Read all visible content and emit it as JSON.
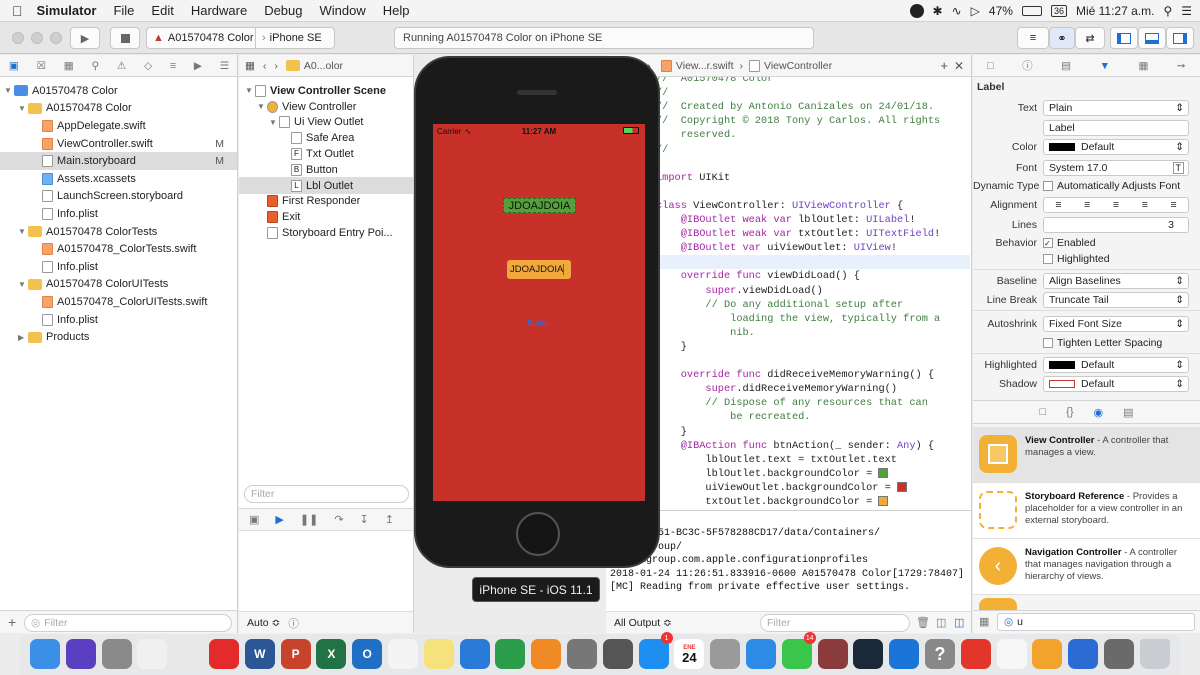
{
  "menubar": {
    "app": "Simulator",
    "items": [
      "File",
      "Edit",
      "Hardware",
      "Debug",
      "Window",
      "Help"
    ],
    "battery": "47%",
    "clock": "Mié 11:27 a.m.",
    "date_badge": "36"
  },
  "toolbar": {
    "scheme": "A01570478 Color",
    "device": "iPhone SE",
    "status": "Running A01570478 Color on iPhone SE"
  },
  "navigator": {
    "items": [
      {
        "label": "A01570478 Color",
        "depth": 0,
        "kind": "project",
        "open": true
      },
      {
        "label": "A01570478 Color",
        "depth": 1,
        "kind": "folder",
        "open": true
      },
      {
        "label": "AppDelegate.swift",
        "depth": 2,
        "kind": "swift"
      },
      {
        "label": "ViewController.swift",
        "depth": 2,
        "kind": "swift",
        "badge": "M"
      },
      {
        "label": "Main.storyboard",
        "depth": 2,
        "kind": "storyboard",
        "badge": "M",
        "selected": true
      },
      {
        "label": "Assets.xcassets",
        "depth": 2,
        "kind": "assets"
      },
      {
        "label": "LaunchScreen.storyboard",
        "depth": 2,
        "kind": "storyboard"
      },
      {
        "label": "Info.plist",
        "depth": 2,
        "kind": "plist"
      },
      {
        "label": "A01570478 ColorTests",
        "depth": 1,
        "kind": "folder",
        "open": true
      },
      {
        "label": "A01570478_ColorTests.swift",
        "depth": 2,
        "kind": "swift"
      },
      {
        "label": "Info.plist",
        "depth": 2,
        "kind": "plist"
      },
      {
        "label": "A01570478 ColorUITests",
        "depth": 1,
        "kind": "folder",
        "open": true
      },
      {
        "label": "A01570478_ColorUITests.swift",
        "depth": 2,
        "kind": "swift"
      },
      {
        "label": "Info.plist",
        "depth": 2,
        "kind": "plist"
      },
      {
        "label": "Products",
        "depth": 1,
        "kind": "folder",
        "open": false
      }
    ],
    "filter_placeholder": "Filter"
  },
  "outline": {
    "jump": "A0...olor",
    "items": [
      {
        "label": "View Controller Scene",
        "depth": 0,
        "bold": true
      },
      {
        "label": "View Controller",
        "depth": 1
      },
      {
        "label": "Ui View Outlet",
        "depth": 2
      },
      {
        "label": "Safe Area",
        "depth": 3
      },
      {
        "label": "Txt Outlet",
        "depth": 3,
        "icon": "F"
      },
      {
        "label": "Button",
        "depth": 3,
        "icon": "B"
      },
      {
        "label": "Lbl Outlet",
        "depth": 3,
        "icon": "L",
        "selected": true
      },
      {
        "label": "First Responder",
        "depth": 1
      },
      {
        "label": "Exit",
        "depth": 1
      },
      {
        "label": "Storyboard Entry Poi...",
        "depth": 1
      }
    ],
    "filter_placeholder": "Filter",
    "auto": "Auto ≎"
  },
  "simulator": {
    "carrier": "Carrier",
    "time": "11:27 AM",
    "label_text": "JDOAJDOIA",
    "field_text": "JDOAJDOIA",
    "button_text": "Button",
    "device_label": "iPhone SE - iOS 11.1",
    "colors": {
      "background": "#c8302a",
      "label_bg": "#54a13c",
      "field_bg": "#f2a93b"
    }
  },
  "editor": {
    "jump": "View...r.swift",
    "jump2": "ViewController",
    "lines": [
      {
        "n": "3",
        "segs": [
          {
            "c": "cm",
            "t": "//  A01570478 Color"
          }
        ]
      },
      {
        "n": "4",
        "segs": [
          {
            "c": "cm",
            "t": "//"
          }
        ]
      },
      {
        "n": "5",
        "segs": [
          {
            "c": "cm",
            "t": "//  Created by Antonio Canizales on 24/01/18."
          }
        ]
      },
      {
        "n": "6",
        "segs": [
          {
            "c": "cm",
            "t": "//  Copyright © 2018 Tony y Carlos. All rights"
          }
        ]
      },
      {
        "n": "",
        "segs": [
          {
            "c": "cm",
            "t": "    reserved."
          }
        ]
      },
      {
        "n": "7",
        "segs": [
          {
            "c": "cm",
            "t": "//"
          }
        ]
      },
      {
        "n": "8",
        "segs": []
      },
      {
        "n": "9",
        "segs": [
          {
            "c": "k",
            "t": "import"
          },
          {
            "c": "",
            "t": " UIKit"
          }
        ]
      },
      {
        "n": "10",
        "segs": []
      },
      {
        "n": "11",
        "segs": [
          {
            "c": "k",
            "t": "class"
          },
          {
            "c": "",
            "t": " ViewController: "
          },
          {
            "c": "ty",
            "t": "UIViewController"
          },
          {
            "c": "",
            "t": " {"
          }
        ]
      },
      {
        "n": "12",
        "bp": true,
        "segs": [
          {
            "c": "k",
            "t": "    @IBOutlet weak var"
          },
          {
            "c": "",
            "t": " lblOutlet: "
          },
          {
            "c": "ty",
            "t": "UILabel"
          },
          {
            "c": "",
            "t": "!"
          }
        ]
      },
      {
        "n": "13",
        "bp": true,
        "segs": [
          {
            "c": "k",
            "t": "    @IBOutlet weak var"
          },
          {
            "c": "",
            "t": " txtOutlet: "
          },
          {
            "c": "ty",
            "t": "UITextField"
          },
          {
            "c": "",
            "t": "!"
          }
        ]
      },
      {
        "n": "14",
        "bp": true,
        "segs": [
          {
            "c": "k",
            "t": "    @IBOutlet var"
          },
          {
            "c": "",
            "t": " uiViewOutlet: "
          },
          {
            "c": "ty",
            "t": "UIView"
          },
          {
            "c": "",
            "t": "!"
          }
        ]
      },
      {
        "n": "15",
        "cur": true,
        "segs": []
      },
      {
        "n": "16",
        "segs": [
          {
            "c": "k",
            "t": "    override func"
          },
          {
            "c": "",
            "t": " viewDidLoad() {"
          }
        ]
      },
      {
        "n": "17",
        "segs": [
          {
            "c": "k",
            "t": "        super"
          },
          {
            "c": "",
            "t": ".viewDidLoad()"
          }
        ]
      },
      {
        "n": "18",
        "segs": [
          {
            "c": "cm",
            "t": "        // Do any additional setup after"
          }
        ]
      },
      {
        "n": "",
        "segs": [
          {
            "c": "cm",
            "t": "            loading the view, typically from a"
          }
        ]
      },
      {
        "n": "",
        "segs": [
          {
            "c": "cm",
            "t": "            nib."
          }
        ]
      },
      {
        "n": "19",
        "segs": [
          {
            "c": "",
            "t": "    }"
          }
        ]
      },
      {
        "n": "20",
        "segs": []
      },
      {
        "n": "21",
        "segs": [
          {
            "c": "k",
            "t": "    override func"
          },
          {
            "c": "",
            "t": " didReceiveMemoryWarning() {"
          }
        ]
      },
      {
        "n": "22",
        "segs": [
          {
            "c": "k",
            "t": "        super"
          },
          {
            "c": "",
            "t": ".didReceiveMemoryWarning()"
          }
        ]
      },
      {
        "n": "23",
        "segs": [
          {
            "c": "cm",
            "t": "        // Dispose of any resources that can"
          }
        ]
      },
      {
        "n": "",
        "segs": [
          {
            "c": "cm",
            "t": "            be recreated."
          }
        ]
      },
      {
        "n": "24",
        "segs": [
          {
            "c": "",
            "t": "    }"
          }
        ]
      },
      {
        "n": "25",
        "bp": true,
        "segs": [
          {
            "c": "k",
            "t": "    @IBAction func"
          },
          {
            "c": "",
            "t": " btnAction(_ sender: "
          },
          {
            "c": "ty",
            "t": "Any"
          },
          {
            "c": "",
            "t": ") {"
          }
        ]
      },
      {
        "n": "26",
        "segs": [
          {
            "c": "",
            "t": "        lblOutlet.text = txtOutlet.text"
          }
        ]
      },
      {
        "n": "27",
        "sw": "#54a13c",
        "segs": [
          {
            "c": "",
            "t": "        lblOutlet.backgroundColor = "
          }
        ]
      },
      {
        "n": "28",
        "sw": "#c8302a",
        "segs": [
          {
            "c": "",
            "t": "        uiViewOutlet.backgroundColor = "
          }
        ]
      },
      {
        "n": "29",
        "sw": "#f2a93b",
        "segs": [
          {
            "c": "",
            "t": "        txtOutlet.backgroundColor = "
          }
        ]
      }
    ]
  },
  "console": {
    "lines": [
      "-51D5-4751-BC3C-5F578288CD17/data/Containers/",
      "SystemGroup/",
      "systemgroup.com.apple.configurationprofiles",
      "2018-01-24 11:26:51.833916-0600 A01570478 Color[1729:78407]",
      "[MC] Reading from private effective user settings."
    ],
    "output_select": "All Output ≎",
    "filter_placeholder": "Filter"
  },
  "inspector": {
    "section": "Label",
    "text_type": "Plain",
    "text_value": "Label",
    "color": "Default",
    "font": "System 17.0",
    "dynamic_type": "Automatically Adjusts Font",
    "lines": "3",
    "enabled": "Enabled",
    "highlighted_chk": "Highlighted",
    "baseline": "Align Baselines",
    "line_break": "Truncate Tail",
    "autoshrink": "Fixed Font Size",
    "tighten": "Tighten Letter Spacing",
    "highlighted": "Default",
    "shadow": "Default",
    "labels": {
      "text": "Text",
      "color": "Color",
      "font": "Font",
      "dynamic": "Dynamic Type",
      "alignment": "Alignment",
      "lines": "Lines",
      "behavior": "Behavior",
      "baseline": "Baseline",
      "linebreak": "Line Break",
      "autoshrink": "Autoshrink",
      "highlighted": "Highlighted",
      "shadow": "Shadow"
    },
    "library": [
      {
        "title": "View Controller",
        "desc": " - A controller that manages a view.",
        "color": "#f2b134"
      },
      {
        "title": "Storyboard Reference",
        "desc": " - Provides a placeholder for a view controller in an external storyboard.",
        "color": "#ffffff"
      },
      {
        "title": "Navigation Controller",
        "desc": " - A controller that manages navigation through a hierarchy of views.",
        "color": "#f2b134"
      }
    ],
    "filter_value": "u"
  },
  "dock": {
    "apps": [
      {
        "name": "finder",
        "color": "#3b8fe6"
      },
      {
        "name": "siri",
        "color": "#5a3fc0"
      },
      {
        "name": "launchpad",
        "color": "#8a8a8a"
      },
      {
        "name": "music",
        "color": "#f0f0f0"
      },
      {
        "name": "chrome",
        "color": "#e8e8e8"
      },
      {
        "name": "youtube",
        "color": "#e32b2b"
      },
      {
        "name": "word",
        "color": "#2b5797"
      },
      {
        "name": "powerpoint",
        "color": "#c8432b"
      },
      {
        "name": "excel",
        "color": "#217346"
      },
      {
        "name": "outlook",
        "color": "#1f6fc5"
      },
      {
        "name": "photos",
        "color": "#f4f4f4"
      },
      {
        "name": "notes",
        "color": "#f6e27a"
      },
      {
        "name": "keynote",
        "color": "#2a7ad8"
      },
      {
        "name": "numbers",
        "color": "#2c9e4b"
      },
      {
        "name": "ibooks",
        "color": "#f08a24"
      },
      {
        "name": "rocket",
        "color": "#777777"
      },
      {
        "name": "calculator",
        "color": "#555555"
      },
      {
        "name": "appstore",
        "color": "#1f8ef1"
      },
      {
        "name": "calendar",
        "color": "#ffffff"
      },
      {
        "name": "settings",
        "color": "#9a9a9a"
      },
      {
        "name": "safari",
        "color": "#2d8ae5"
      },
      {
        "name": "messages",
        "color": "#3ac64b"
      },
      {
        "name": "dictionary",
        "color": "#8a3b3b"
      },
      {
        "name": "steam",
        "color": "#1b2838"
      },
      {
        "name": "xcode",
        "color": "#1b74d8"
      },
      {
        "name": "help",
        "color": "#888888"
      },
      {
        "name": "roblox",
        "color": "#e2352b"
      },
      {
        "name": "reminders",
        "color": "#f7f7f7"
      },
      {
        "name": "game",
        "color": "#f2a32b"
      },
      {
        "name": "simulator",
        "color": "#2a6bd4"
      },
      {
        "name": "blank",
        "color": "#6a6a6a"
      },
      {
        "name": "trash",
        "color": "#c9ccd1"
      }
    ],
    "calendar_month": "ENE",
    "calendar_day": "24",
    "appstore_badge": "1",
    "messages_badge": "14"
  }
}
